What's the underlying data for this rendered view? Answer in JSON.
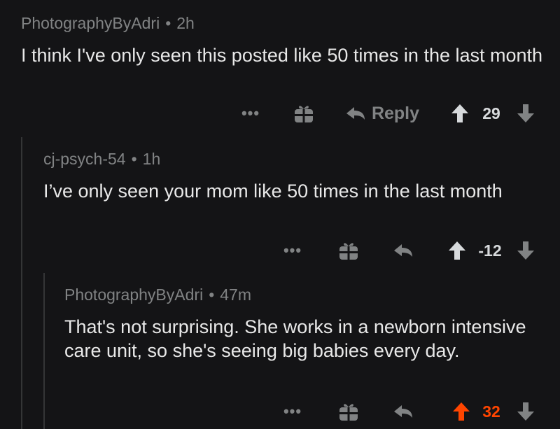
{
  "comments": [
    {
      "author": "PhotographyByAdri",
      "separator": "•",
      "time": "2h",
      "text": "I think I've only seen this posted like 50 times in the last month",
      "more": "•••",
      "reply_label": "Reply",
      "score": "29",
      "upvoted": false
    },
    {
      "author": "cj-psych-54",
      "separator": "•",
      "time": "1h",
      "text": "I’ve only seen your mom like 50 times in the last month",
      "more": "•••",
      "reply_label": "",
      "score": "-12",
      "upvoted": false
    },
    {
      "author": "PhotographyByAdri",
      "separator": "•",
      "time": "47m",
      "text": "That's not surprising. She works in a newborn intensive care unit, so she's seeing big babies every day.",
      "more": "•••",
      "reply_label": "",
      "score": "32",
      "upvoted": true
    }
  ],
  "colors": {
    "background": "#141416",
    "meta": "#818384",
    "text": "#e8e8e8",
    "upvote_active": "#ff4500",
    "thread_line": "#343536"
  },
  "icons": [
    "more-icon",
    "award-icon",
    "reply-arrow-icon",
    "upvote-icon",
    "downvote-icon"
  ]
}
